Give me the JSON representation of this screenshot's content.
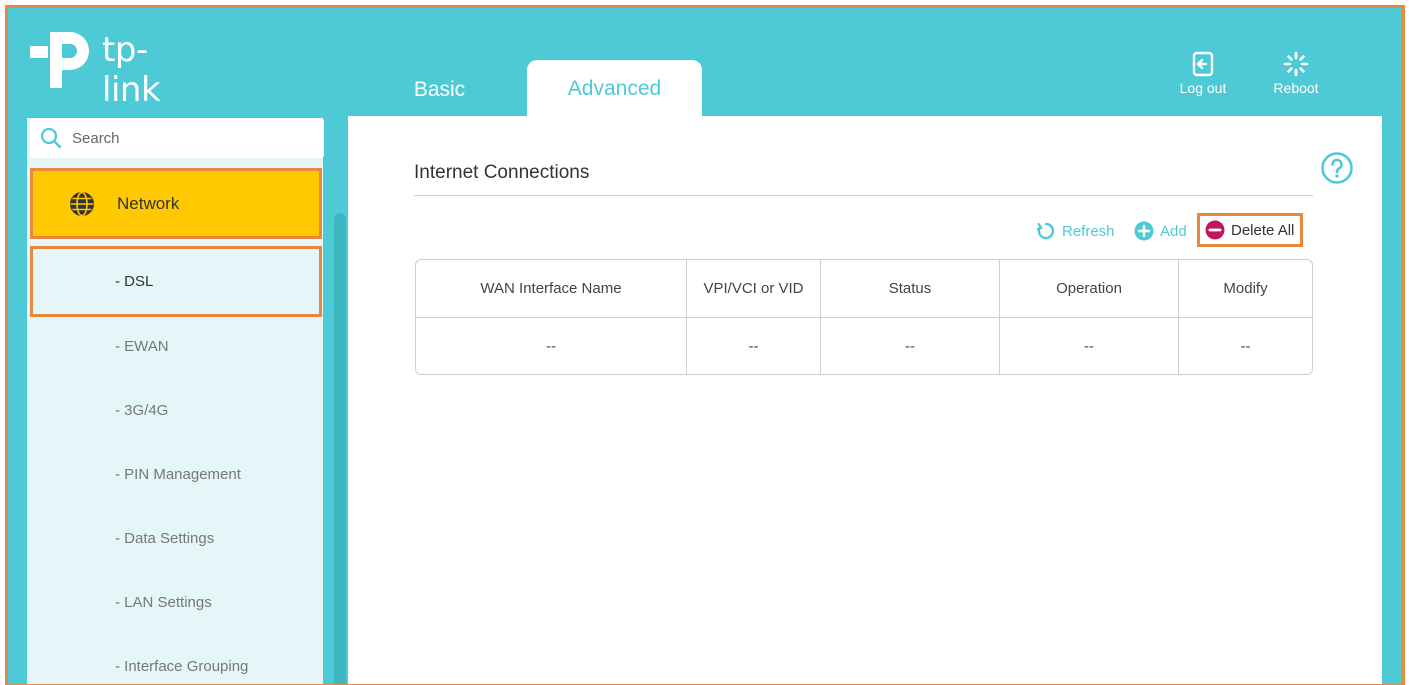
{
  "brand": {
    "name": "tp-link"
  },
  "tabs": [
    {
      "label": "Basic",
      "active": false
    },
    {
      "label": "Advanced",
      "active": true
    }
  ],
  "top_actions": {
    "logout_label": "Log out",
    "reboot_label": "Reboot"
  },
  "search": {
    "placeholder": "Search"
  },
  "sidebar": {
    "section": {
      "label": "Network",
      "icon": "globe-icon"
    },
    "items": [
      {
        "label": "- DSL",
        "active": true
      },
      {
        "label": "- EWAN"
      },
      {
        "label": "- 3G/4G"
      },
      {
        "label": "- PIN Management"
      },
      {
        "label": "- Data Settings"
      },
      {
        "label": "- LAN Settings"
      },
      {
        "label": "- Interface Grouping"
      }
    ]
  },
  "main": {
    "title": "Internet Connections",
    "toolbar": {
      "refresh": "Refresh",
      "add": "Add",
      "delete_all": "Delete All"
    },
    "table": {
      "headers": [
        "WAN Interface Name",
        "VPI/VCI or VID",
        "Status",
        "Operation",
        "Modify"
      ],
      "rows": [
        [
          "--",
          "--",
          "--",
          "--",
          "--"
        ]
      ]
    }
  },
  "colors": {
    "accent": "#4ecad6",
    "highlight": "#ffc800",
    "annotation": "#e8883c",
    "delete": "#c2185b"
  }
}
